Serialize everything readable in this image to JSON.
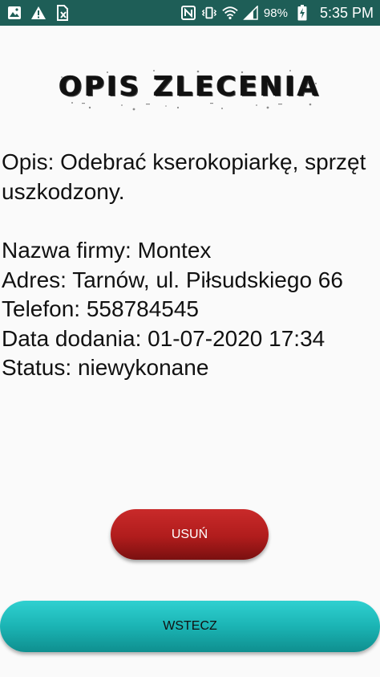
{
  "status_bar": {
    "left_icons": [
      "image-icon",
      "warning-icon",
      "no-sim-icon"
    ],
    "right_icons": [
      "nfc-icon",
      "vibrate-icon",
      "wifi-icon",
      "signal-icon",
      "battery-charging-icon"
    ],
    "battery_percent": "98%",
    "time": "5:35 PM",
    "background_color": "#1e5e57"
  },
  "header": {
    "title": "OPIS ZLECENIA"
  },
  "details": {
    "description": "Opis: Odebrać kserokopiarkę, sprzęt uszkodzony.",
    "company": "Nazwa firmy: Montex",
    "address": "Adres: Tarnów, ul. Piłsudskiego 66",
    "phone": "Telefon: 558784545",
    "date_added": "Data dodania: 01-07-2020 17:34",
    "status": "Status: niewykonane"
  },
  "buttons": {
    "delete_label": "USUŃ",
    "delete_color": "#b01c1c",
    "back_label": "WSTECZ",
    "back_color": "#1bb4b4"
  }
}
